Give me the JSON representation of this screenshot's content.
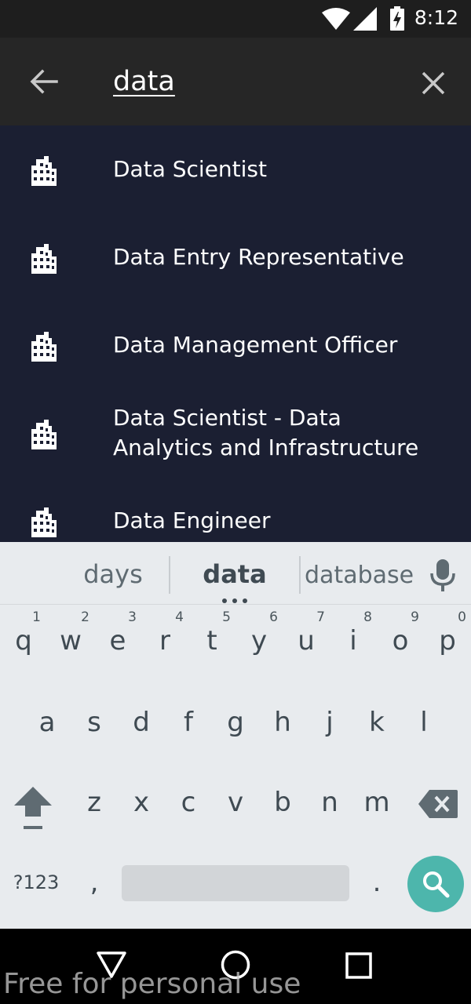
{
  "status_bar": {
    "time": "8:12",
    "icons": [
      "wifi-icon",
      "signal-icon",
      "battery-charging-icon"
    ]
  },
  "search": {
    "query": "data",
    "back_icon": "arrow-back-icon",
    "clear_icon": "close-icon"
  },
  "results": [
    {
      "label": "Data Scientist",
      "icon": "company-building-icon"
    },
    {
      "label": "Data Entry Representative",
      "icon": "company-building-icon"
    },
    {
      "label": "Data Management Officer",
      "icon": "company-building-icon"
    },
    {
      "label": "Data Scientist - Data Analytics and Infrastructure",
      "icon": "company-building-icon"
    },
    {
      "label": "Data Engineer",
      "icon": "company-building-icon"
    }
  ],
  "keyboard": {
    "suggestions": [
      "days",
      "data",
      "database"
    ],
    "row1": [
      {
        "char": "q",
        "hint": "1"
      },
      {
        "char": "w",
        "hint": "2"
      },
      {
        "char": "e",
        "hint": "3"
      },
      {
        "char": "r",
        "hint": "4"
      },
      {
        "char": "t",
        "hint": "5"
      },
      {
        "char": "y",
        "hint": "6"
      },
      {
        "char": "u",
        "hint": "7"
      },
      {
        "char": "i",
        "hint": "8"
      },
      {
        "char": "o",
        "hint": "9"
      },
      {
        "char": "p",
        "hint": "0"
      }
    ],
    "row2": [
      "a",
      "s",
      "d",
      "f",
      "g",
      "h",
      "j",
      "k",
      "l"
    ],
    "row3": [
      "z",
      "x",
      "c",
      "v",
      "b",
      "n",
      "m"
    ],
    "symbols_label": "?123",
    "comma": ",",
    "period": ".",
    "accent_color": "#4db6ac"
  },
  "nav_bar": {
    "buttons": [
      "back-triangle-icon",
      "home-circle-icon",
      "recents-square-icon"
    ]
  },
  "watermark": "Free for personal use"
}
